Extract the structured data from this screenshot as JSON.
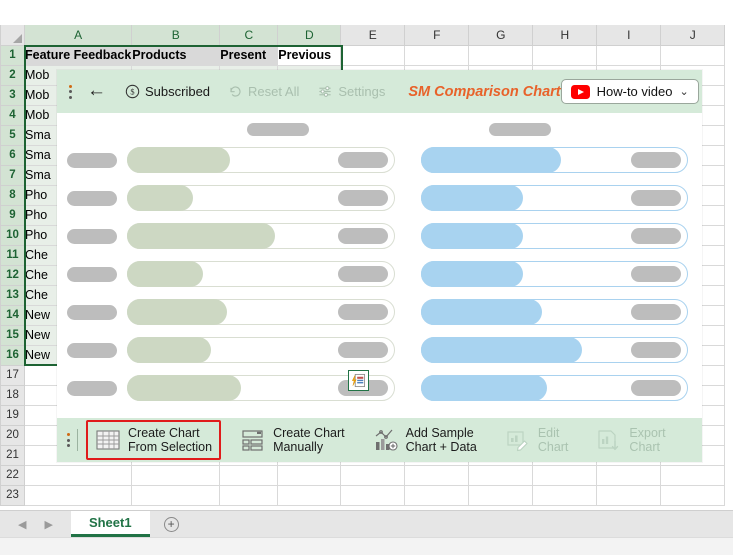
{
  "spreadsheet": {
    "column_headers": [
      "A",
      "B",
      "C",
      "D",
      "E",
      "F",
      "G",
      "H",
      "I",
      "J"
    ],
    "row_headers": [
      "1",
      "2",
      "3",
      "4",
      "5",
      "6",
      "7",
      "8",
      "9",
      "10",
      "11",
      "12",
      "13",
      "14",
      "15",
      "16",
      "17",
      "18",
      "19",
      "20",
      "21",
      "22",
      "23"
    ],
    "header_row": {
      "a": "Feature Feedback",
      "b": "Products",
      "c": "Present",
      "d": "Previous"
    },
    "column_a_values": [
      "Mob",
      "Mob",
      "Mob",
      "Sma",
      "Sma",
      "Sma",
      "Pho",
      "Pho",
      "Pho",
      "Che",
      "Che",
      "Che",
      "New",
      "New",
      "New"
    ],
    "active_cell": "Previous"
  },
  "addin": {
    "toolbar": {
      "back_label": "←",
      "subscribed_label": "Subscribed",
      "reset_all_label": "Reset All",
      "settings_label": "Settings",
      "title": "SM Comparison Chart",
      "howto_label": "How-to video",
      "chevron": "⌄"
    },
    "actions": [
      {
        "label_line1": "Create Chart",
        "label_line2": "From Selection",
        "state": "selected"
      },
      {
        "label_line1": "Create Chart",
        "label_line2": "Manually",
        "state": "enabled"
      },
      {
        "label_line1": "Add Sample",
        "label_line2": "Chart + Data",
        "state": "enabled"
      },
      {
        "label_line1": "Edit",
        "label_line2": "Chart",
        "state": "disabled"
      },
      {
        "label_line1": "Export",
        "label_line2": "Chart",
        "state": "disabled"
      }
    ],
    "skeleton": {
      "title_pill_left_pct": 29,
      "title_pill_left_width": 62,
      "title_pill_right_pct": 68,
      "title_pill_right_width": 62,
      "rows": [
        {
          "green_fill_pct": 38,
          "blue_fill_pct": 52
        },
        {
          "green_fill_pct": 24,
          "blue_fill_pct": 38
        },
        {
          "green_fill_pct": 55,
          "blue_fill_pct": 38
        },
        {
          "green_fill_pct": 28,
          "blue_fill_pct": 38
        },
        {
          "green_fill_pct": 37,
          "blue_fill_pct": 45
        },
        {
          "green_fill_pct": 31,
          "blue_fill_pct": 60
        },
        {
          "green_fill_pct": 42,
          "blue_fill_pct": 47
        }
      ]
    }
  },
  "colors": {
    "addin_bar": "#d5ead9",
    "accent_orange": "#e8622a",
    "green_fill": "#cdd8c3",
    "blue_fill": "#a8d3f0",
    "skeleton_grey": "#bdbdbd",
    "selection_red": "#e01b1b",
    "excel_green": "#217346"
  },
  "sheet_tabs": {
    "prev_arrow": "◀",
    "next_arrow": "▶",
    "tabs": [
      "Sheet1"
    ],
    "active_tab": "Sheet1",
    "add_label": "+"
  }
}
